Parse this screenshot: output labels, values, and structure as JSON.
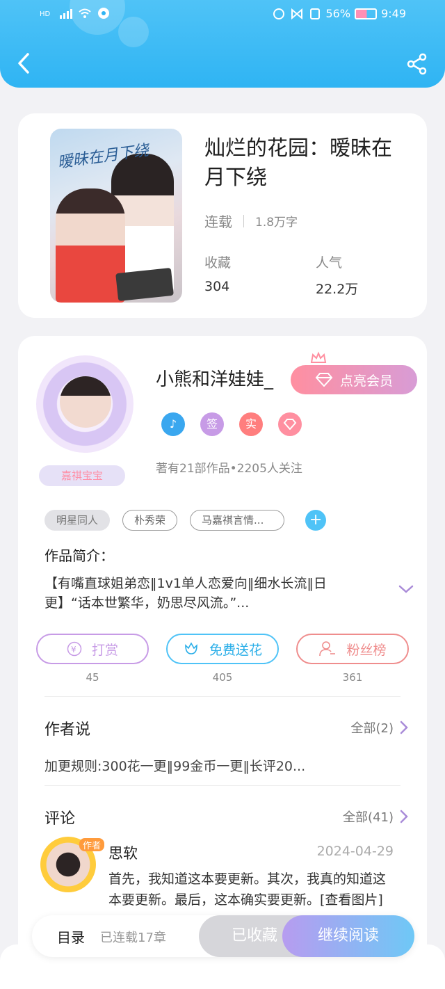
{
  "status_bar": {
    "battery": "56%",
    "time": "9:49"
  },
  "book": {
    "cover_title": "暧昧在月下绕",
    "title": "灿烂的花园：暧昧在月下绕",
    "status": "连载",
    "word_count": "1.8万字",
    "favorites_label": "收藏",
    "favorites_value": "304",
    "popularity_label": "人气",
    "popularity_value": "22.2万"
  },
  "author": {
    "name": "小熊和洋娃娃_",
    "avatar_tag": "嘉祺宝宝",
    "vip_label": "点亮会员",
    "badges": [
      "签",
      "实"
    ],
    "stats": "著有21部作品•2205人关注"
  },
  "tags": [
    "明星同人",
    "朴秀荣",
    "马嘉祺言情..."
  ],
  "intro": {
    "label": "作品简介：",
    "text": "【有嘴直球姐弟恋‖1v1单人恋爱向‖细水长流‖日更】“话本世繁华，奶思尽风流。”..."
  },
  "actions": [
    {
      "label": "打赏",
      "count": "45"
    },
    {
      "label": "免费送花",
      "count": "405"
    },
    {
      "label": "粉丝榜",
      "count": "361"
    }
  ],
  "author_says": {
    "title": "作者说",
    "more": "全部(2)",
    "text": "加更规则:300花一更‖99金币一更‖长评20..."
  },
  "comments": {
    "title": "评论",
    "more": "全部(41)",
    "item": {
      "badge": "作者",
      "name": "思软",
      "date": "2024-04-29",
      "text": "首先，我知道这本要更新。其次，我真的知道这本要更新。最后，这本确实要更新。[查看图片]"
    }
  },
  "bottom_bar": {
    "toc": "目录",
    "chapters": "已连载17章",
    "collected": "已收藏",
    "continue": "继续阅读"
  },
  "colors": {
    "header": "#4fc3f7",
    "vip": "#ff8fa0",
    "reward": "#c79be6",
    "flower": "#4fc3f7",
    "fans": "#ef8d8d"
  }
}
